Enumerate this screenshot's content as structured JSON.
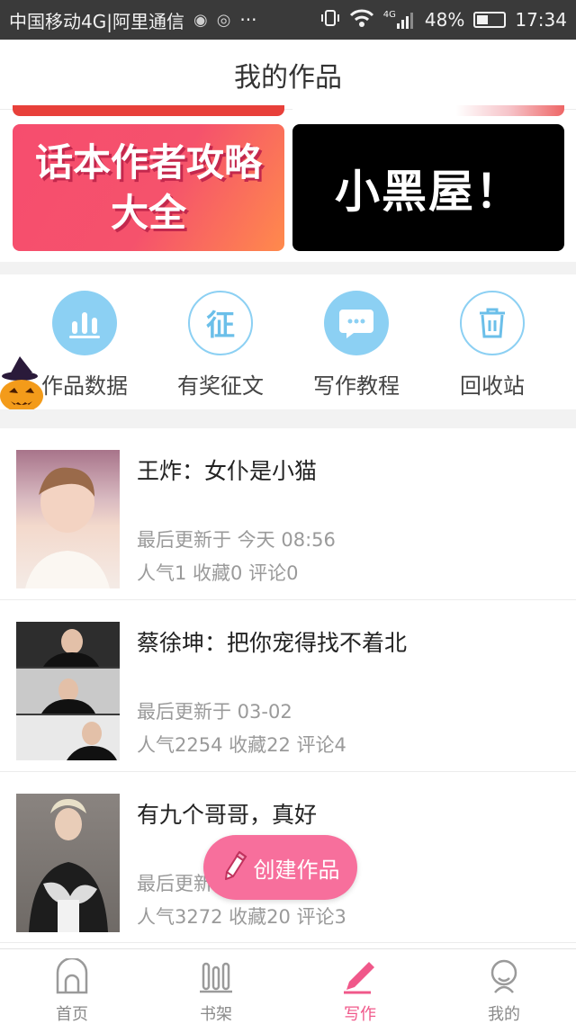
{
  "status_bar": {
    "carrier": "中国移动4G|阿里通信",
    "more": "···",
    "net_type": "4G",
    "battery": "48%",
    "battery_level": 0.48,
    "time": "17:34"
  },
  "header": {
    "title": "我的作品"
  },
  "banners": [
    {
      "text_line1": "话本作者攻略",
      "text_line2": "大全",
      "color": "#f64d6e"
    },
    {
      "text": "小黑屋！",
      "color": "#000000"
    }
  ],
  "quick_actions": [
    {
      "label": "作品数据",
      "icon": "bar-chart-icon"
    },
    {
      "label": "有奖征文",
      "icon": "contest-icon",
      "glyph": "征"
    },
    {
      "label": "写作教程",
      "icon": "chat-bubble-icon"
    },
    {
      "label": "回收站",
      "icon": "trash-icon"
    }
  ],
  "works": [
    {
      "title": "王炸：女仆是小猫",
      "updated": "最后更新于 今天 08:56",
      "stats": "人气1 收藏0 评论0"
    },
    {
      "title": "蔡徐坤：把你宠得找不着北",
      "updated": "最后更新于 03-02",
      "stats": "人气2254 收藏22 评论4"
    },
    {
      "title": "有九个哥哥，真好",
      "updated": "最后更新于",
      "stats": "人气3272 收藏20 评论3"
    }
  ],
  "fab": {
    "label": "创建作品"
  },
  "tabbar": [
    {
      "label": "首页",
      "icon": "home-icon"
    },
    {
      "label": "书架",
      "icon": "bookshelf-icon"
    },
    {
      "label": "写作",
      "icon": "pen-icon",
      "active": true
    },
    {
      "label": "我的",
      "icon": "profile-icon"
    }
  ],
  "colors": {
    "accent": "#f0588a",
    "icon_blue": "#8cd0f3",
    "banner_pink": "#f64d6e"
  }
}
